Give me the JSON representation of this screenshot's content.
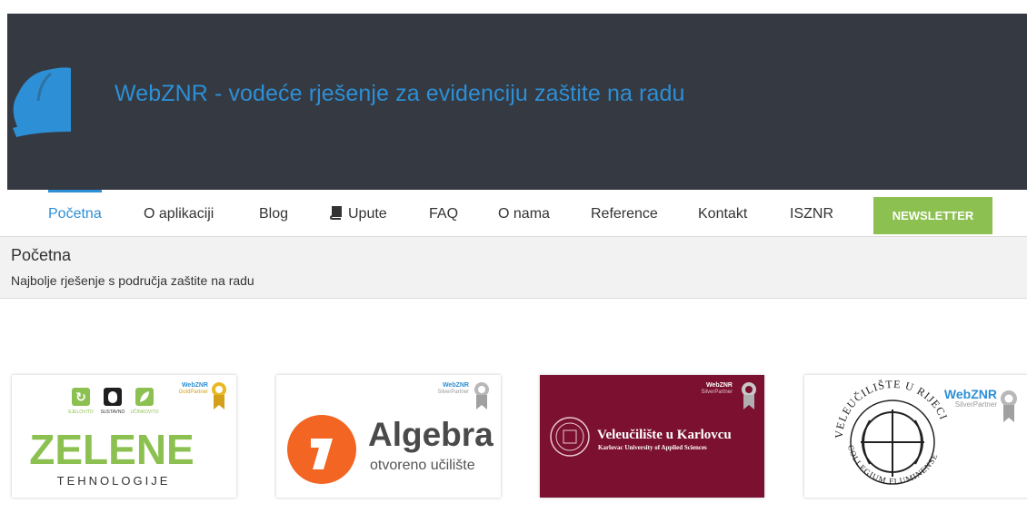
{
  "header": {
    "title": "WebZNR - vodeće rješenje za evidenciju zaštite na radu",
    "logo_icon": "hard-hat-icon"
  },
  "nav": {
    "items": [
      {
        "label": "Početna",
        "active": true
      },
      {
        "label": "O aplikaciji"
      },
      {
        "label": "Blog"
      },
      {
        "label": "Upute",
        "icon": "book-icon"
      },
      {
        "label": "FAQ"
      },
      {
        "label": "O nama"
      },
      {
        "label": "Reference"
      },
      {
        "label": "Kontakt"
      },
      {
        "label": "ISZNR"
      }
    ],
    "newsletter_label": "NEWSLETTER"
  },
  "breadcrumb": {
    "title": "Početna",
    "subtitle": "Najbolje rješenje s područja zaštite na radu"
  },
  "partners": [
    {
      "badge_brand": "WebZNR",
      "badge_tier": "GoldPartner",
      "name_line1": "ZELENE",
      "name_line2": "TEHNOLOGIJE",
      "icon_labels": [
        "EJELOVITO",
        "SUSTAVNO",
        "UČINKOVITO"
      ]
    },
    {
      "badge_brand": "WebZNR",
      "badge_tier": "SilverPartner",
      "name_line1": "Algebra",
      "name_line2": "otvoreno učilište"
    },
    {
      "badge_brand": "WebZNR",
      "badge_tier": "SilverPartner",
      "name_line1": "Veleučilište u Karlovcu",
      "name_line2": "Karlovac University of Applied Sciences"
    },
    {
      "badge_brand": "WebZNR",
      "badge_tier": "SilverPartner",
      "seal_text_top": "VELEUČILIŠTE U RIJECI",
      "seal_text_bottom": "COLLEGIUM FLUMINENSE"
    }
  ],
  "colors": {
    "header_bg": "#353941",
    "accent_blue": "#2d8fd5",
    "newsletter_green": "#8cc152",
    "zelene_green": "#8cc152",
    "algebra_orange": "#f26522",
    "karlovac_maroon": "#7b1030"
  }
}
